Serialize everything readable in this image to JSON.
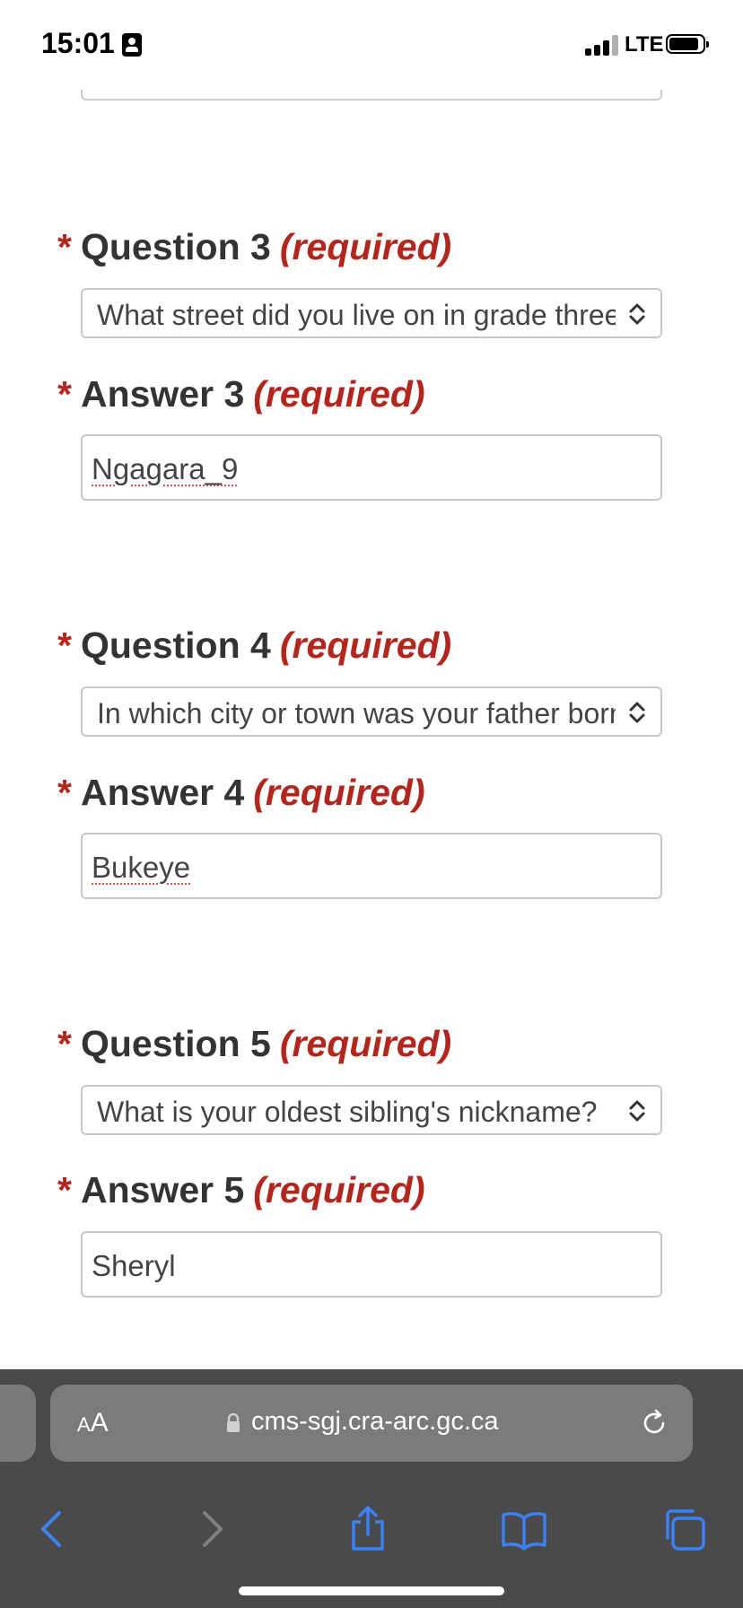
{
  "status_bar": {
    "time": "15:01",
    "network": "LTE"
  },
  "form": {
    "groups": [
      {
        "question_label": "Question 3",
        "question_value": "What street did you live on in grade three?",
        "answer_label": "Answer 3",
        "answer_value": "Ngagara_9"
      },
      {
        "question_label": "Question 4",
        "question_value": "In which city or town was your father born?",
        "answer_label": "Answer 4",
        "answer_value": "Bukeye"
      },
      {
        "question_label": "Question 5",
        "question_value": "What is your oldest sibling's nickname?",
        "answer_label": "Answer 5",
        "answer_value": "Sheryl"
      }
    ],
    "required_star": "*",
    "required_text": "(required)"
  },
  "browser": {
    "aa_small": "A",
    "aa_big": "A",
    "url": "cms-sgj.cra-arc.gc.ca",
    "colors": {
      "accent": "#3b82f6",
      "required": "#b3261e"
    }
  }
}
